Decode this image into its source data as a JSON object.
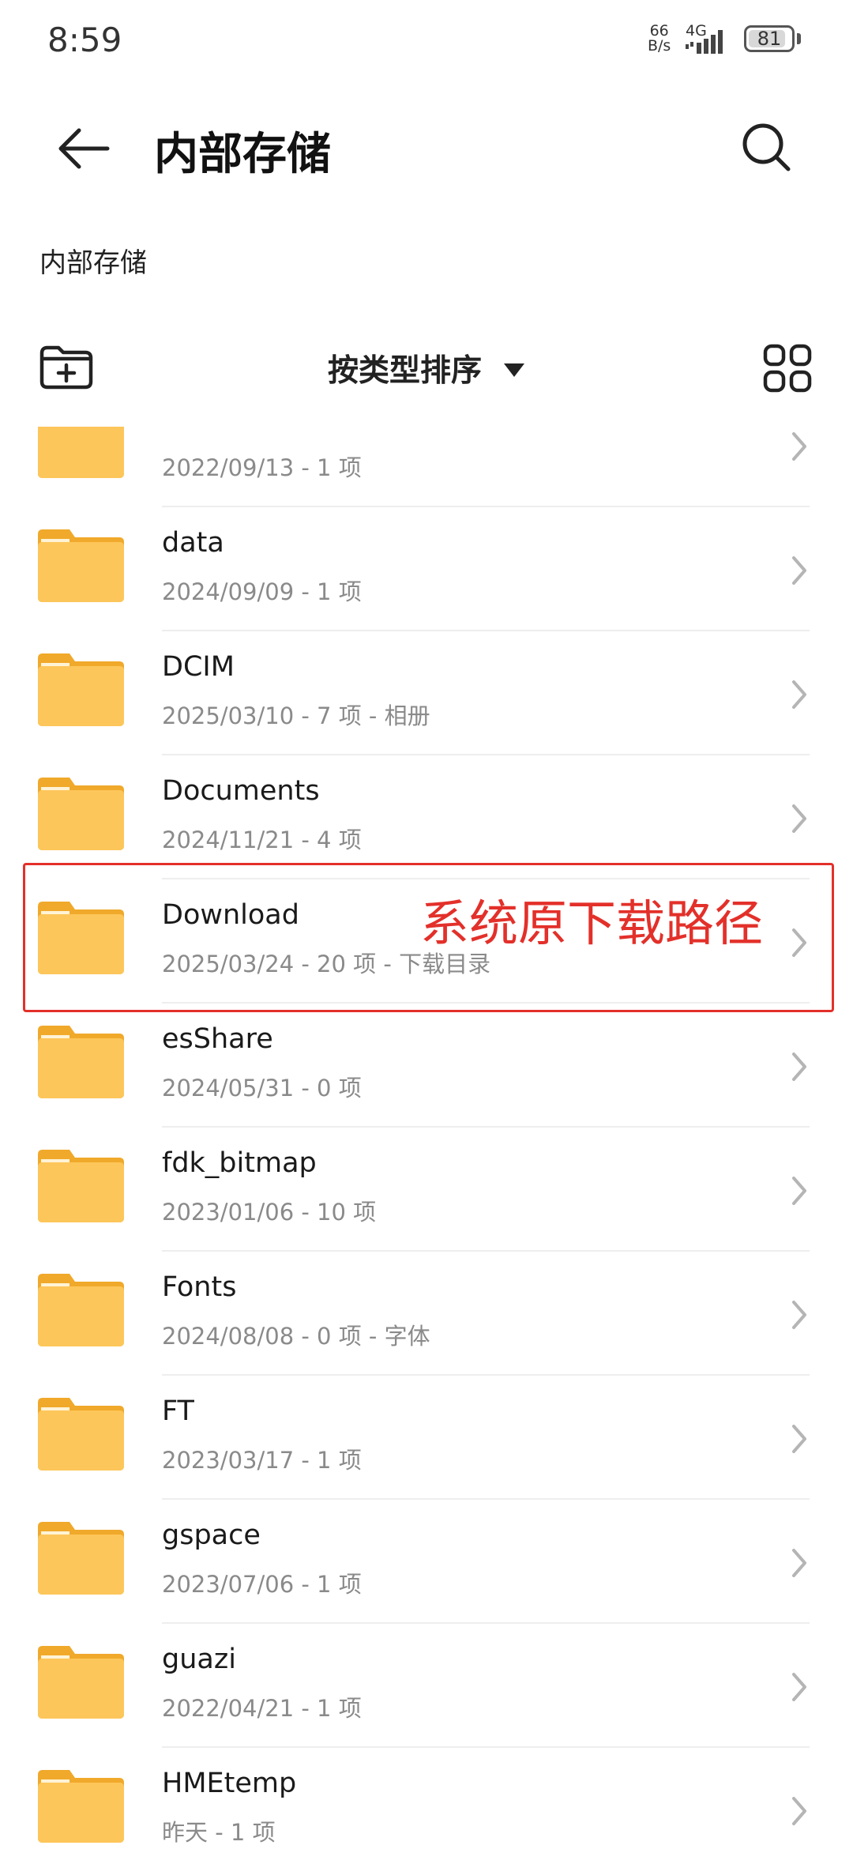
{
  "status": {
    "time": "8:59",
    "net_speed_top": "66",
    "net_speed_bottom": "B/s",
    "network": "4G",
    "battery": "81"
  },
  "header": {
    "title": "内部存储"
  },
  "breadcrumb": "内部存储",
  "toolbar": {
    "sort_label": "按类型排序"
  },
  "folders": [
    {
      "name": "",
      "meta": "2022/09/13 - 1 项"
    },
    {
      "name": "data",
      "meta": "2024/09/09 - 1 项"
    },
    {
      "name": "DCIM",
      "meta": "2025/03/10 - 7 项 - 相册"
    },
    {
      "name": "Documents",
      "meta": "2024/11/21 - 4 项"
    },
    {
      "name": "Download",
      "meta": "2025/03/24 - 20 项 - 下载目录"
    },
    {
      "name": "esShare",
      "meta": "2024/05/31 - 0 项"
    },
    {
      "name": "fdk_bitmap",
      "meta": "2023/01/06 - 10 项"
    },
    {
      "name": "Fonts",
      "meta": "2024/08/08 - 0 项 - 字体"
    },
    {
      "name": "FT",
      "meta": "2023/03/17 - 1 项"
    },
    {
      "name": "gspace",
      "meta": "2023/07/06 - 1 项"
    },
    {
      "name": "guazi",
      "meta": "2022/04/21 - 1 项"
    },
    {
      "name": "HMEtemp",
      "meta": "昨天 - 1 项"
    }
  ],
  "annotation": "系统原下载路径",
  "colors": {
    "folder": "#fdc65a",
    "folder_tab": "#f0a92a",
    "highlight": "#e3302a"
  }
}
